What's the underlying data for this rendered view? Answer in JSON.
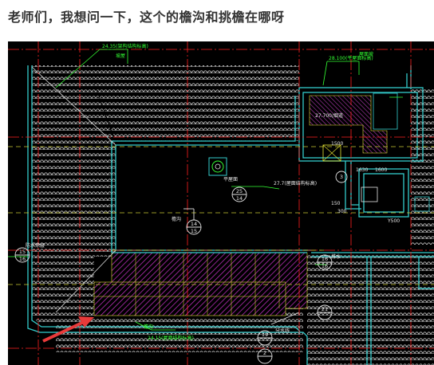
{
  "post": {
    "title": "老师们，我想问一下，这个的檐沟和挑檐在哪呀"
  },
  "drawing": {
    "labels": {
      "top_left_note": "24.35(架构结构标高)",
      "top_left_sub": "坡屋",
      "right_top_note": "28.100(平屋面标高)",
      "right_top_sub": "屋面坡",
      "flue": "27.700/烟道",
      "level_mid": "27.7(屋面结构标高)",
      "bottom_left_note": "24.15(屋面结构标高)",
      "bottom_left_sub": "檐沟",
      "dim_1600": "1600",
      "dim_1500": "1500",
      "dim_1630": "1630",
      "dim_500": "Y500",
      "dim_150": "150",
      "dim_300": "300",
      "ref_15": "15",
      "ref_16": "16",
      "ref_25": "25",
      "ref_14a": "14",
      "ref_14b": "14",
      "ref_15b": "15",
      "ref_16b": "16",
      "ref_16c": "16",
      "ref_21": "21",
      "ref_19": "19",
      "ref_2": "2",
      "ref_3": "3",
      "small_a": "防水涂层",
      "small_b": "平屋面",
      "small_c": "檐沟",
      "small_d": "排水",
      "small_e": "分水线"
    },
    "colors": {
      "background": "#000000",
      "wall": "#33cccc",
      "grid_line": "#ff2020",
      "dash_line": "#cccc33",
      "tile": "#d8d8d8",
      "hatch": "#cc33cc",
      "annotation": "#33ff33",
      "arrow": "#e83a3a"
    }
  }
}
